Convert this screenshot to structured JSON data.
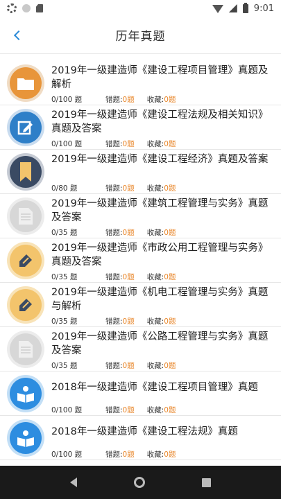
{
  "status_bar": {
    "time": "9:01",
    "icons": [
      "gear-icon",
      "circle-icon",
      "sd-card-icon",
      "wifi-icon",
      "signal-icon",
      "battery-icon"
    ]
  },
  "header": {
    "title": "历年真题",
    "back_icon": "chevron-left-icon"
  },
  "labels": {
    "wrong": "错题:",
    "fav": "收藏:"
  },
  "items": [
    {
      "title": "2019年一级建造师《建设工程项目管理》真题及解析",
      "count": "0/100 题",
      "wrong": "0题",
      "fav": "0题",
      "icon": "folder-icon",
      "color": "#e8953a"
    },
    {
      "title": "2019年一级建造师《建设工程法规及相关知识》真题及答案",
      "count": "0/100 题",
      "wrong": "0题",
      "fav": "0题",
      "icon": "edit-icon",
      "color": "#2e7fc8"
    },
    {
      "title": "2019年一级建造师《建设工程经济》真题及答案",
      "count": "0/80 题",
      "wrong": "0题",
      "fav": "0题",
      "icon": "bookmark-icon",
      "color": "#3a4a63"
    },
    {
      "title": "2019年一级建造师《建筑工程管理与实务》真题及答案",
      "count": "0/35 题",
      "wrong": "0题",
      "fav": "0题",
      "icon": "document-icon",
      "color": "#d7d7d7"
    },
    {
      "title": "2019年一级建造师《市政公用工程管理与实务》真题及答案",
      "count": "0/35 题",
      "wrong": "0题",
      "fav": "0题",
      "icon": "pencil-icon",
      "color": "#f3c46c"
    },
    {
      "title": "2019年一级建造师《机电工程管理与实务》真题与解析",
      "count": "0/35 题",
      "wrong": "0题",
      "fav": "0题",
      "icon": "pencil-icon",
      "color": "#f3c46c"
    },
    {
      "title": "2019年一级建造师《公路工程管理与实务》真题及答案",
      "count": "0/35 题",
      "wrong": "0题",
      "fav": "0题",
      "icon": "document-icon",
      "color": "#d7d7d7"
    },
    {
      "title": "2018年一级建造师《建设工程项目管理》真题",
      "count": "0/100 题",
      "wrong": "0题",
      "fav": "0题",
      "icon": "reader-icon",
      "color": "#2d8de0"
    },
    {
      "title": "2018年一级建造师《建设工程法规》真题",
      "count": "0/100 题",
      "wrong": "0题",
      "fav": "0题",
      "icon": "reader-icon",
      "color": "#2d8de0"
    }
  ]
}
